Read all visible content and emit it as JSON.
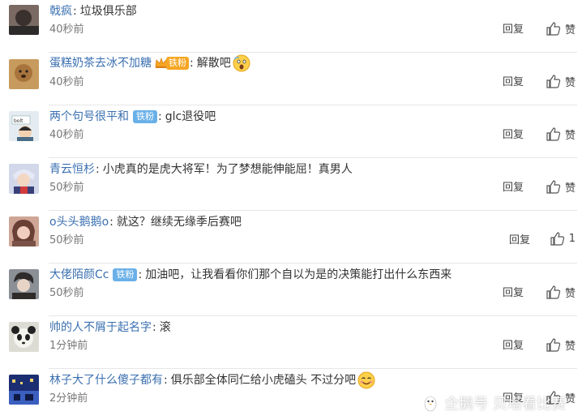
{
  "comments": [
    {
      "user": "戟疯",
      "user_color": "#3a6fb0",
      "text": "垃圾俱乐部",
      "time": "40秒前",
      "reply": "回复",
      "like": "赞",
      "badge": "",
      "emoji": false,
      "avatar_colors": [
        "#6a5b55",
        "#2d2a2a"
      ]
    },
    {
      "user": "蛋糕奶茶去冰不加糖",
      "user_color": "#3a6fb0",
      "text": "解散吧",
      "time": "40秒前",
      "reply": "回复",
      "like": "赞",
      "badge": "铁粉",
      "badge_type": "crown",
      "emoji": true,
      "avatar_colors": [
        "#c08a4a",
        "#6b4a2a"
      ]
    },
    {
      "user": "两个句号很平和",
      "user_color": "#3a6fb0",
      "text": "glc退役吧",
      "time": "40秒前",
      "reply": "回复",
      "like": "赞",
      "badge": "铁粉",
      "badge_type": "blue",
      "emoji": false,
      "avatar_colors": [
        "#dfe8ee",
        "#4a6c86"
      ]
    },
    {
      "user": "青云恒杉",
      "user_color": "#3a6fb0",
      "text": "小虎真的是虎大将军！为了梦想能伸能屈！真男人",
      "time": "50秒前",
      "reply": "回复",
      "like": "赞",
      "badge": "",
      "emoji": false,
      "avatar_colors": [
        "#c8cfe6",
        "#3a3f7a"
      ]
    },
    {
      "user": "o头头鹅鹅o",
      "user_color": "#3a6fb0",
      "text": "就这？继续无缘季后赛吧",
      "time": "50秒前",
      "reply": "回复",
      "like": "1",
      "badge": "",
      "emoji": false,
      "avatar_colors": [
        "#d8b2a4",
        "#7a5248"
      ]
    },
    {
      "user": "大佬陌颜Cc",
      "user_color": "#3a6fb0",
      "text": "加油吧，让我看看你们那个自以为是的决策能打出什么东西来",
      "time": "50秒前",
      "reply": "回复",
      "like": "赞",
      "badge": "铁粉",
      "badge_type": "blue",
      "emoji": false,
      "avatar_colors": [
        "#8b8f96",
        "#2e2b2a"
      ]
    },
    {
      "user": "帅的人不屑于起名字",
      "user_color": "#3a6fb0",
      "text": "滚",
      "time": "1分钟前",
      "reply": "回复",
      "like": "赞",
      "badge": "",
      "emoji": false,
      "avatar_colors": [
        "#e8e8e2",
        "#222222"
      ]
    },
    {
      "user": "林子大了什么傻子都有",
      "user_color": "#3a6fb0",
      "text": "俱乐部全体同仁给小虎磕头 不过分吧",
      "time": "2分钟前",
      "reply": "回复",
      "like": "赞",
      "badge": "",
      "emoji": true,
      "avatar_colors": [
        "#3a5fbf",
        "#17275e"
      ]
    }
  ],
  "watermark": {
    "text": "企鹅号 贝塔看比赛"
  },
  "colors": {
    "accent": "#3a6fb0",
    "badge_blue": "#6ab0e8",
    "badge_gold": "#f6a623"
  },
  "icons": {
    "like": "thumbs-up-icon",
    "emoji": "smile-emoji-icon",
    "watermark_logo": "penguin-icon"
  }
}
